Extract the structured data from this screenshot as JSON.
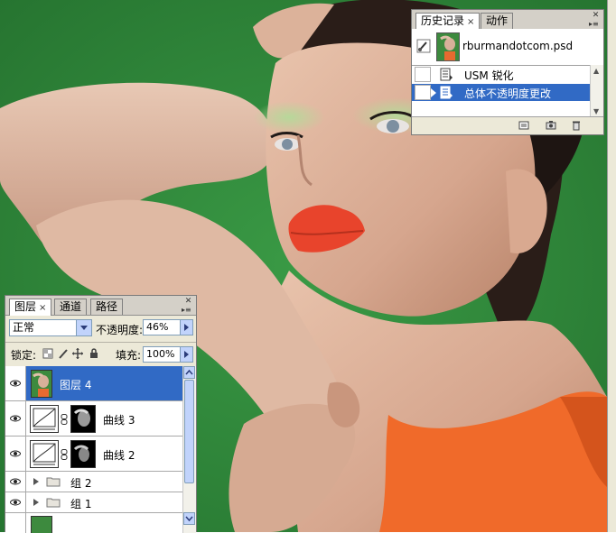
{
  "history_panel": {
    "tabs": [
      {
        "label": "历史记录",
        "active": true,
        "close": "×"
      },
      {
        "label": "动作",
        "active": false
      }
    ],
    "snapshot": {
      "label": "rburmandotcom.psd"
    },
    "items": [
      {
        "label": "USM 锐化",
        "selected": false
      },
      {
        "label": "总体不透明度更改",
        "selected": true
      }
    ],
    "footer_icons": [
      "new-document-icon",
      "camera-icon",
      "trash-icon"
    ]
  },
  "layers_panel": {
    "tabs": [
      {
        "label": "图层",
        "active": true,
        "close": "×"
      },
      {
        "label": "通道",
        "active": false
      },
      {
        "label": "路径",
        "active": false
      }
    ],
    "blend_mode": "正常",
    "opacity_label": "不透明度:",
    "opacity_value": "46%",
    "lock_label": "锁定:",
    "fill_label": "填充:",
    "fill_value": "100%",
    "layers": [
      {
        "name": "图层 4",
        "selected": true,
        "type": "image"
      },
      {
        "name": "曲线 3",
        "selected": false,
        "type": "curves"
      },
      {
        "name": "曲线 2",
        "selected": false,
        "type": "curves"
      },
      {
        "name": "组 2",
        "selected": false,
        "type": "group"
      },
      {
        "name": "组 1",
        "selected": false,
        "type": "group"
      }
    ]
  },
  "colors": {
    "background_green": "#2f8a3c",
    "selection_blue": "#316ac5",
    "panel_gray": "#ece9d8",
    "dress_orange": "#f06a2a",
    "lips_red": "#e8442c"
  }
}
